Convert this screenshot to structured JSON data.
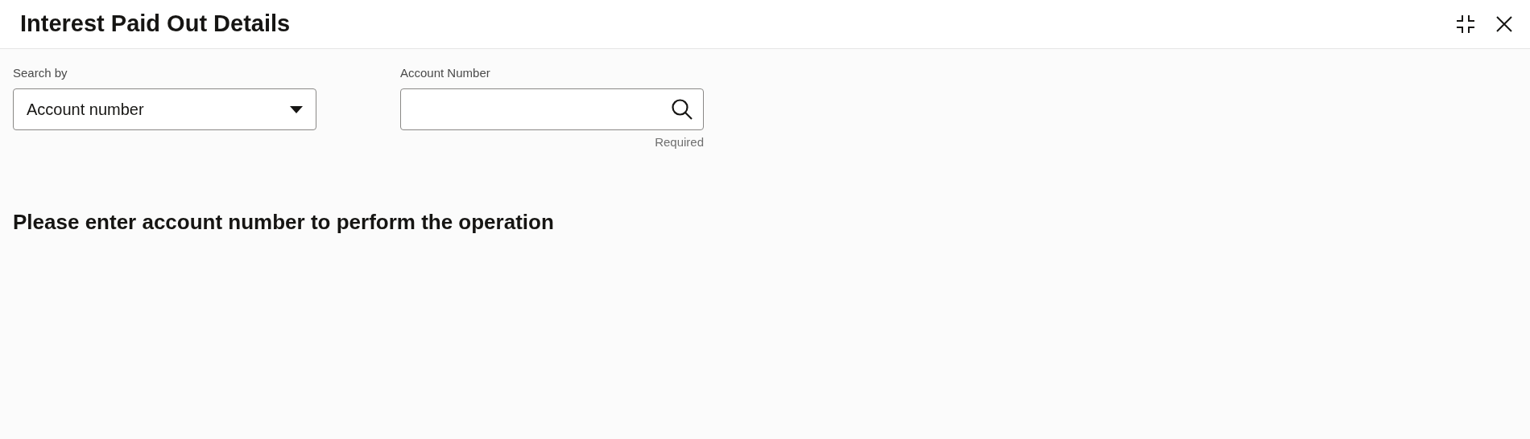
{
  "window": {
    "title": "Interest Paid Out Details"
  },
  "search_by": {
    "label": "Search by",
    "value": "Account number"
  },
  "account_number": {
    "label": "Account Number",
    "hint": "Required"
  },
  "message": "Please enter account number to perform the operation"
}
